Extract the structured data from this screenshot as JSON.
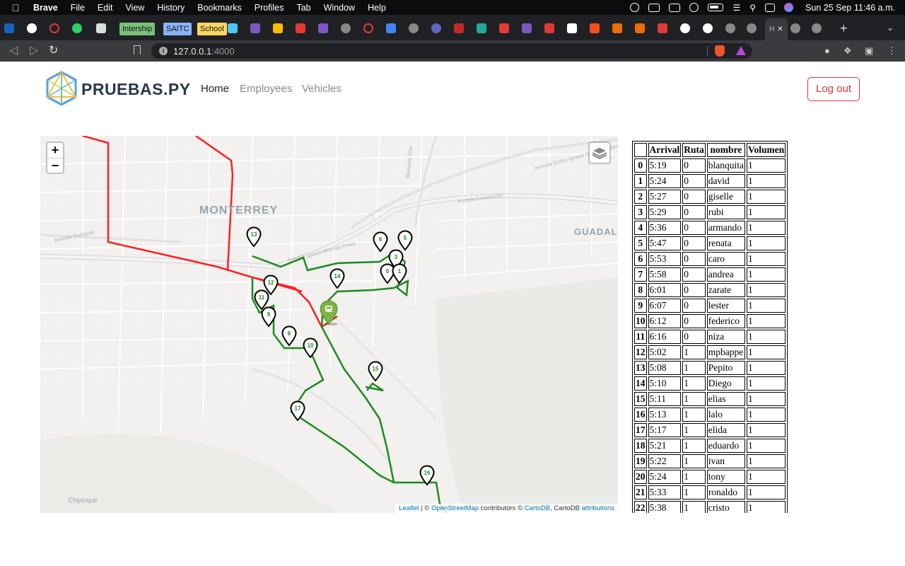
{
  "os_menubar": {
    "app": "Brave",
    "items": [
      "File",
      "Edit",
      "View",
      "History",
      "Bookmarks",
      "Profiles",
      "Tab",
      "Window",
      "Help"
    ],
    "clock": "Sun 25 Sep  11:46 a.m."
  },
  "browser": {
    "tab_labels": [
      "Intership",
      "SAITC",
      "School"
    ],
    "active_tab_letter": "H",
    "url_host": "127.0.0.1",
    "url_port": ":4000"
  },
  "app": {
    "brand": "PRUEBAS.PY",
    "nav": [
      {
        "label": "Home",
        "active": true
      },
      {
        "label": "Employees",
        "active": false
      },
      {
        "label": "Vehicles",
        "active": false
      }
    ],
    "logout_label": "Log out"
  },
  "map": {
    "zoom_in": "+",
    "zoom_out": "−",
    "place_labels": [
      "MONTERREY",
      "GUADAL",
      "Chipinque"
    ],
    "street_labels": [
      "Blanquita Chur",
      "Avenida Doctor Ignacio Morones Prieto",
      "Avenida Constitución",
      "Avenida Rodriguez",
      "Avenida Ignacio Morones Prieto"
    ],
    "route_colors": {
      "route0": "#ff2020",
      "route1": "#1e8a1e",
      "pins": "#1e8a1e"
    },
    "stop_markers": [
      "13",
      "6",
      "5",
      "3",
      "0",
      "1",
      "14",
      "12",
      "11",
      "9",
      "8",
      "10",
      "15",
      "17",
      "16"
    ],
    "attribution": {
      "leaflet": "Leaflet",
      "sep": " | © ",
      "osm": "OpenStreetMap",
      "contrib": " contributors © ",
      "carto": "CartoDB",
      "carto2": ", CartoDB ",
      "attributions": "attributions"
    }
  },
  "table": {
    "headers": [
      "",
      "Arrival",
      "Ruta",
      "nombre",
      "Volumen"
    ],
    "rows": [
      [
        "0",
        "5:19",
        "0",
        "blanquita",
        "1"
      ],
      [
        "1",
        "5:24",
        "0",
        "david",
        "1"
      ],
      [
        "2",
        "5:27",
        "0",
        "giselle",
        "1"
      ],
      [
        "3",
        "5:29",
        "0",
        "rubi",
        "1"
      ],
      [
        "4",
        "5:36",
        "0",
        "armando",
        "1"
      ],
      [
        "5",
        "5:47",
        "0",
        "renata",
        "1"
      ],
      [
        "6",
        "5:53",
        "0",
        "caro",
        "1"
      ],
      [
        "7",
        "5:58",
        "0",
        "andrea",
        "1"
      ],
      [
        "8",
        "6:01",
        "0",
        "zarate",
        "1"
      ],
      [
        "9",
        "6:07",
        "0",
        "lester",
        "1"
      ],
      [
        "10",
        "6:12",
        "0",
        "federico",
        "1"
      ],
      [
        "11",
        "6:16",
        "0",
        "niza",
        "1"
      ],
      [
        "12",
        "5:02",
        "1",
        "mpbappe",
        "1"
      ],
      [
        "13",
        "5:08",
        "1",
        "Pepito",
        "1"
      ],
      [
        "14",
        "5:10",
        "1",
        "Diego",
        "1"
      ],
      [
        "15",
        "5:11",
        "1",
        "elias",
        "1"
      ],
      [
        "16",
        "5:13",
        "1",
        "lalo",
        "1"
      ],
      [
        "17",
        "5:17",
        "1",
        "elida",
        "1"
      ],
      [
        "18",
        "5:21",
        "1",
        "eduardo",
        "1"
      ],
      [
        "19",
        "5:22",
        "1",
        "ivan",
        "1"
      ],
      [
        "20",
        "5:24",
        "1",
        "tony",
        "1"
      ],
      [
        "21",
        "5:33",
        "1",
        "ronaldo",
        "1"
      ],
      [
        "22",
        "5:38",
        "1",
        "cristo",
        "1"
      ]
    ]
  }
}
